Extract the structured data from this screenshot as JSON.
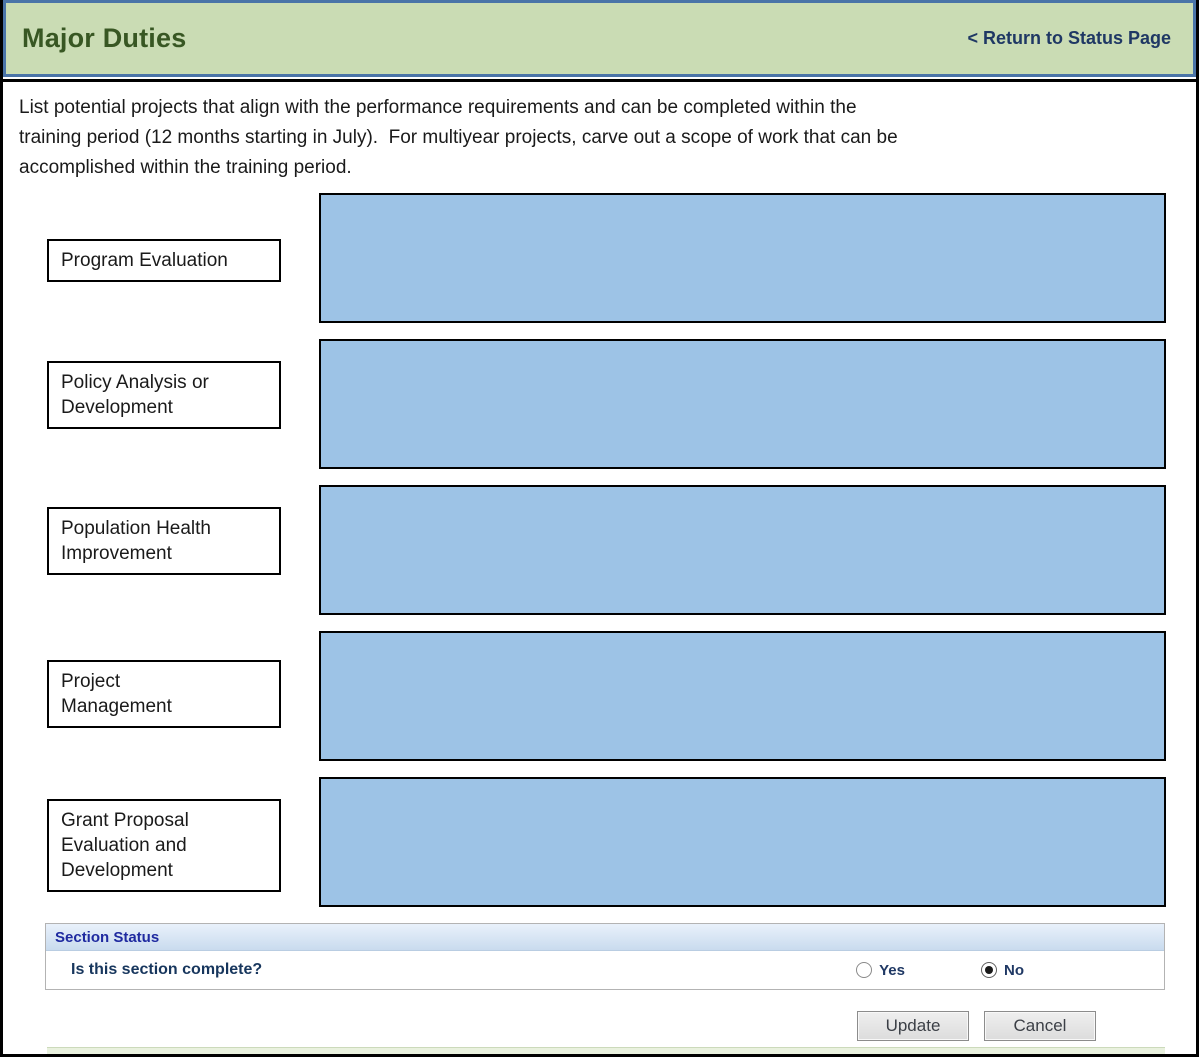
{
  "header": {
    "title": "Major Duties",
    "return_link": "< Return to Status Page"
  },
  "instructions": "List potential projects that align with the performance requirements and can be completed within the\ntraining period (12 months starting in July).  For multiyear projects, carve out a scope of work that can be\naccomplished within the training period.",
  "duties": [
    {
      "label": "Program Evaluation",
      "value": ""
    },
    {
      "label": "Policy Analysis or\nDevelopment",
      "value": ""
    },
    {
      "label": "Population Health\nImprovement",
      "value": ""
    },
    {
      "label": "Project\nManagement",
      "value": ""
    },
    {
      "label": "Grant Proposal\nEvaluation and\nDevelopment",
      "value": ""
    }
  ],
  "section_status": {
    "title": "Section Status",
    "question": "Is this section complete?",
    "options": [
      {
        "label": "Yes",
        "selected": false
      },
      {
        "label": "No",
        "selected": true
      }
    ]
  },
  "actions": {
    "update_label": "Update",
    "cancel_label": "Cancel"
  },
  "colors": {
    "header_bg": "#cadcb4",
    "header_border": "#4a74a8",
    "header_title": "#385723",
    "link_text": "#1f3864",
    "textarea_fill": "#9dc3e6",
    "status_header_bg_top": "#e9f1fb",
    "status_header_bg_bottom": "#c9dbee",
    "status_header_text": "#1f2aa0",
    "status_question_text": "#17365d",
    "footer_strip": "#e9f1de"
  }
}
